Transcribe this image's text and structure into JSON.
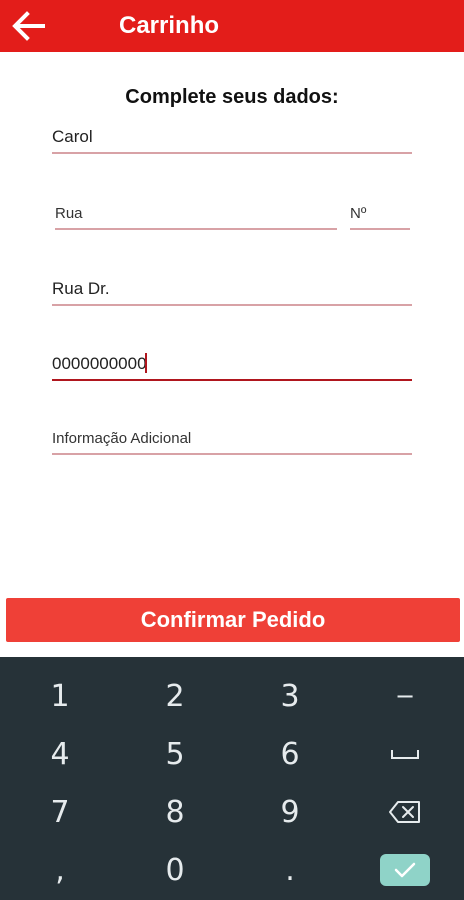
{
  "appbar": {
    "title": "Carrinho",
    "back_icon": "arrow-left-icon"
  },
  "form": {
    "heading": "Complete seus dados:",
    "name_value": "Carol",
    "street_placeholder": "Rua",
    "number_placeholder": "Nº",
    "complement_value": "Rua Dr.",
    "phone_value": "0000000000",
    "additional_info_placeholder": "Informação Adicional"
  },
  "confirm_button": {
    "label": "Confirmar Pedido"
  },
  "keyboard": {
    "keys": {
      "k1": "1",
      "k2": "2",
      "k3": "3",
      "minus": "−",
      "k4": "4",
      "k5": "5",
      "k6": "6",
      "space": "␣",
      "k7": "7",
      "k8": "8",
      "k9": "9",
      "backspace_icon": "backspace-icon",
      "comma": ",",
      "k0": "0",
      "period": ".",
      "enter_icon": "checkmark-icon"
    }
  },
  "colors": {
    "appbar": "#e31d1a",
    "button": "#ef4037",
    "keyboard_bg": "#263238",
    "underline": "#d8a2a6",
    "underline_focused": "#b0161e",
    "enter_key": "#8fd3c8"
  }
}
